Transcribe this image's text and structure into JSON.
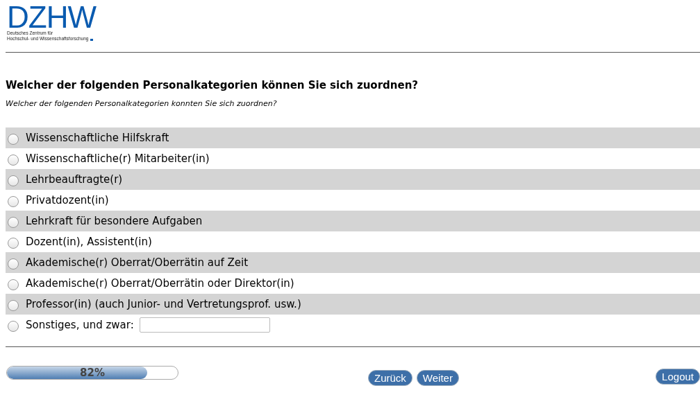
{
  "logo": {
    "mark": "DZHW",
    "line_1": "Deutsches Zentrum für",
    "line_2": "Hochschul- und Wissenschaftsforschung"
  },
  "question": {
    "title": "Welcher der folgenden Personalkategorien können Sie sich zuordnen?",
    "subtitle": "Welcher der folgenden Personalkategorien konnten Sie sich zuordnen?"
  },
  "options": [
    {
      "label": "Wissenschaftliche Hilfskraft",
      "selected": false,
      "kind": "plain"
    },
    {
      "label": "Wissenschaftliche(r) Mitarbeiter(in)",
      "selected": false,
      "kind": "plain"
    },
    {
      "label": "Lehrbeauftragte(r)",
      "selected": false,
      "kind": "plain"
    },
    {
      "label": "Privatdozent(in)",
      "selected": false,
      "kind": "plain"
    },
    {
      "label": "Lehrkraft für besondere Aufgaben",
      "selected": false,
      "kind": "plain"
    },
    {
      "label": "Dozent(in), Assistent(in)",
      "selected": false,
      "kind": "plain"
    },
    {
      "label": "Akademische(r) Oberrat/Oberrätin auf Zeit",
      "selected": false,
      "kind": "plain"
    },
    {
      "label": "Akademische(r) Oberrat/Oberrätin oder Direktor(in)",
      "selected": false,
      "kind": "plain"
    },
    {
      "label": "Professor(in) (auch Junior- und Vertretungsprof. usw.)",
      "selected": false,
      "kind": "plain"
    },
    {
      "label": "Sonstiges, und zwar:",
      "selected": false,
      "kind": "other"
    }
  ],
  "progress": {
    "level": 0.82,
    "label": "82%"
  },
  "buttons": {
    "back": "Zurück",
    "next": "Weiter",
    "logout": "Logout"
  }
}
